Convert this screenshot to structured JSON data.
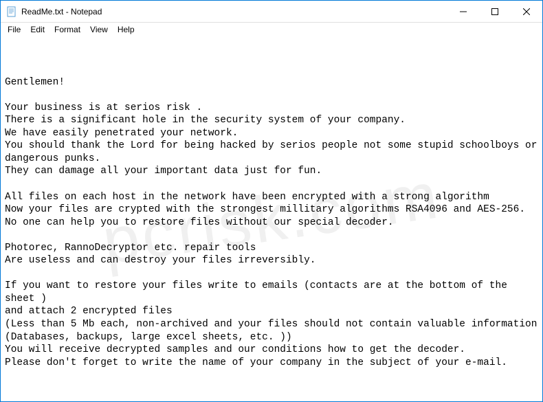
{
  "titlebar": {
    "title": "ReadMe.txt - Notepad"
  },
  "menu": {
    "file": "File",
    "edit": "Edit",
    "format": "Format",
    "view": "View",
    "help": "Help"
  },
  "content": {
    "text": "Gentlemen!\n\nYour business is at serios risk .\nThere is a significant hole in the security system of your company.\nWe have easily penetrated your network.\nYou should thank the Lord for being hacked by serios people not some stupid schoolboys or dangerous punks.\nThey can damage all your important data just for fun.\n\nAll files on each host in the network have been encrypted with a strong algorithm\nNow your files are crypted with the strongest millitary algorithms RSA4096 and AES-256.\nNo one can help you to restore files without our special decoder.\n\nPhotorec, RannoDecryptor etc. repair tools\nAre useless and can destroy your files irreversibly.\n\nIf you want to restore your files write to emails (contacts are at the bottom of the sheet )\nand attach 2 encrypted files\n(Less than 5 Mb each, non-archived and your files should not contain valuable information\n(Databases, backups, large excel sheets, etc. ))\nYou will receive decrypted samples and our conditions how to get the decoder.\nPlease don't forget to write the name of your company in the subject of your e-mail."
  },
  "watermark": "pcrisk.com"
}
